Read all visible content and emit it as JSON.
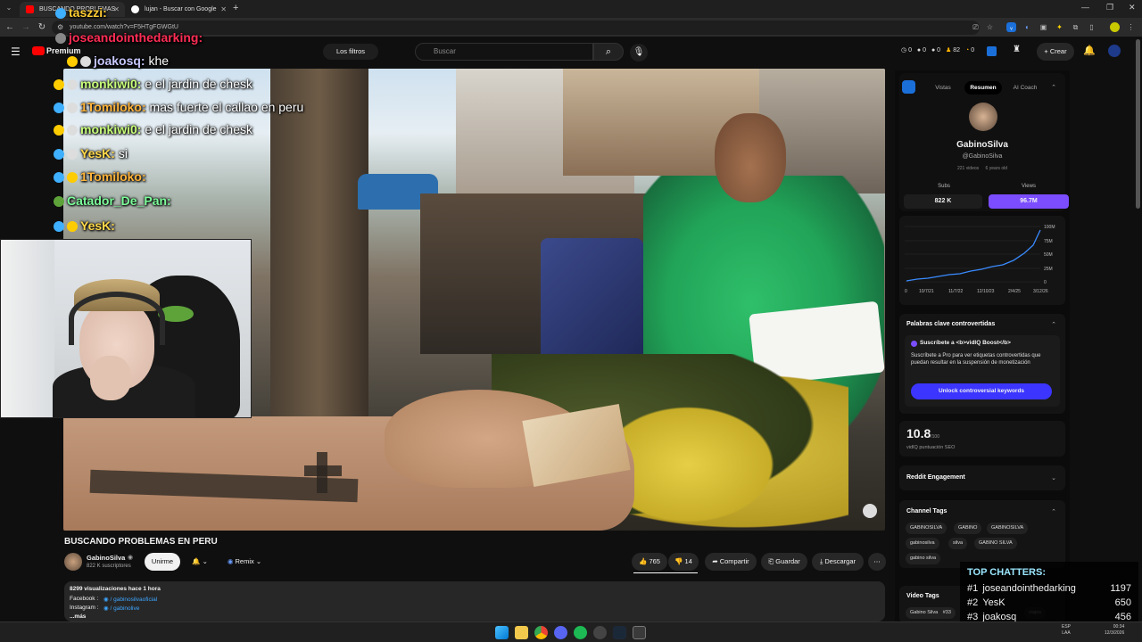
{
  "browser": {
    "tabs": [
      {
        "label": "BUSCANDO PROBLEMAS",
        "color": "#ff0000"
      },
      {
        "label": "lujan - Buscar con Google",
        "color": "#4285f4"
      }
    ],
    "url": "youtube.com/watch?v=F5HTgFGWGtU"
  },
  "yt": {
    "brand": "Premium",
    "filters_label": "Los filtros",
    "search_placeholder": "Buscar",
    "stats_bar": [
      "0",
      "0",
      "0",
      "82",
      "0"
    ],
    "create_label": "Crear"
  },
  "chat": [
    {
      "user": "taszzi:",
      "msg": "",
      "color": "#ffcc33"
    },
    {
      "user": "joseandointhedarking:",
      "msg": "",
      "color": "#ff2d55"
    },
    {
      "user": "joakosq:",
      "msg": "khe",
      "color": "#c7c7ff"
    },
    {
      "user": "monkiwi0:",
      "msg": "e el jardin de chesk",
      "color": "#c8ff7a"
    },
    {
      "user": "1Tomiloko:",
      "msg": "mas fuerte el callao en peru",
      "color": "#ffb43a"
    },
    {
      "user": "monkiwi0:",
      "msg": "e el jardin de chesk",
      "color": "#c8ff7a"
    },
    {
      "user": "YesK:",
      "msg": "si",
      "color": "#ffd84a"
    },
    {
      "user": "1Tomiloko:",
      "msg": "",
      "color": "#ffb43a"
    },
    {
      "user": "Catador_De_Pan:",
      "msg": "",
      "color": "#7dff9b"
    },
    {
      "user": "YesK:",
      "msg": "",
      "color": "#ffd84a"
    }
  ],
  "video": {
    "title": "BUSCANDO PROBLEMAS EN PERU",
    "channel": "GabinoSilva",
    "subscribers": "822 K suscriptores",
    "join_label": "Unirme",
    "remix_label": "Remix",
    "likes": "765",
    "dislikes": "14",
    "share_label": "Compartir",
    "save_label": "Guardar",
    "download_label": "Descargar",
    "description": {
      "stats": "8299 visualizaciones  hace 1 hora",
      "facebook": "Facebook :",
      "facebook_handle": "/ gabinosilvaoficial",
      "instagram": "Instagram :",
      "instagram_handle": "/ gabinolive",
      "more": "...más"
    }
  },
  "vidiq": {
    "tabs": [
      "Vistas",
      "Resumen",
      "AI Coach"
    ],
    "active_tab": "Resumen",
    "channel_name": "GabinoSilva",
    "handle": "@GabinoSilva",
    "videos_count": "221 videos",
    "age": "6 years old",
    "subs_label": "Subs",
    "subs_value": "822 K",
    "views_label": "Views",
    "views_value": "96.7M",
    "chart_y_ticks": [
      "100M",
      "75M",
      "50M",
      "25M",
      "0"
    ],
    "chart_x_ticks": [
      "0",
      "10/7/21",
      "11/7/22",
      "12/10/23",
      "2/4/25",
      "3/12/26"
    ],
    "keywords_title": "Palabras clave controvertidas",
    "pro_title": "Suscríbete a <b>vidIQ Boost</b>",
    "pro_text": "Suscríbete a Pro para ver etiquetas controvertidas que puedan resultar en la suspensión de monetización",
    "unlock_label": "Unlock controversial keywords",
    "seo_score": "10.8",
    "seo_max": "/100",
    "seo_label": "vidIQ puntuación SEO",
    "reddit_label": "Reddit Engagement",
    "channel_tags_label": "Channel Tags",
    "channel_tags": [
      "GABINOSILVA",
      "GABINO",
      "GABINOSILVA",
      "gabinosilva",
      "silva",
      "GABINO SILVA",
      "gabino silva"
    ],
    "video_tags_label": "Video Tags",
    "video_tag_first": "Gabino Silva",
    "video_tag_count": "#33",
    "video_tag_trailing": "viajes"
  },
  "top_chatters": {
    "title": "TOP CHATTERS:",
    "rows": [
      {
        "rank": "#1",
        "name": "joseandointhedarking",
        "count": "1197"
      },
      {
        "rank": "#2",
        "name": "YesK",
        "count": "650"
      },
      {
        "rank": "#3",
        "name": "joakosq",
        "count": "456"
      }
    ]
  },
  "taskbar": {
    "lang": "ESP",
    "lang2": "LAA",
    "time": "00:34",
    "date": "12/3/2026"
  }
}
